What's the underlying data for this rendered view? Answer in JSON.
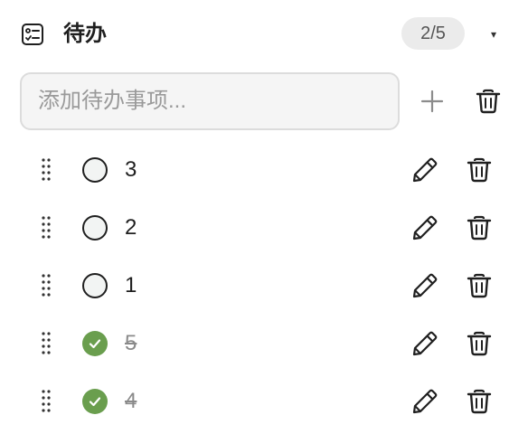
{
  "header": {
    "title": "待办",
    "counter": "2/5",
    "caret": "▾"
  },
  "add": {
    "placeholder": "添加待办事项..."
  },
  "todos": [
    {
      "text": "3",
      "done": false
    },
    {
      "text": "2",
      "done": false
    },
    {
      "text": "1",
      "done": false
    },
    {
      "text": "5",
      "done": true
    },
    {
      "text": "4",
      "done": true
    }
  ],
  "colors": {
    "done_check": "#6a9e4e",
    "counter_bg": "#ebebeb"
  },
  "icons": {
    "header": "checklist-icon",
    "add": "plus-icon",
    "clear": "trash-icon",
    "drag": "drag-handle-icon",
    "edit": "pencil-icon",
    "delete": "trash-icon"
  }
}
